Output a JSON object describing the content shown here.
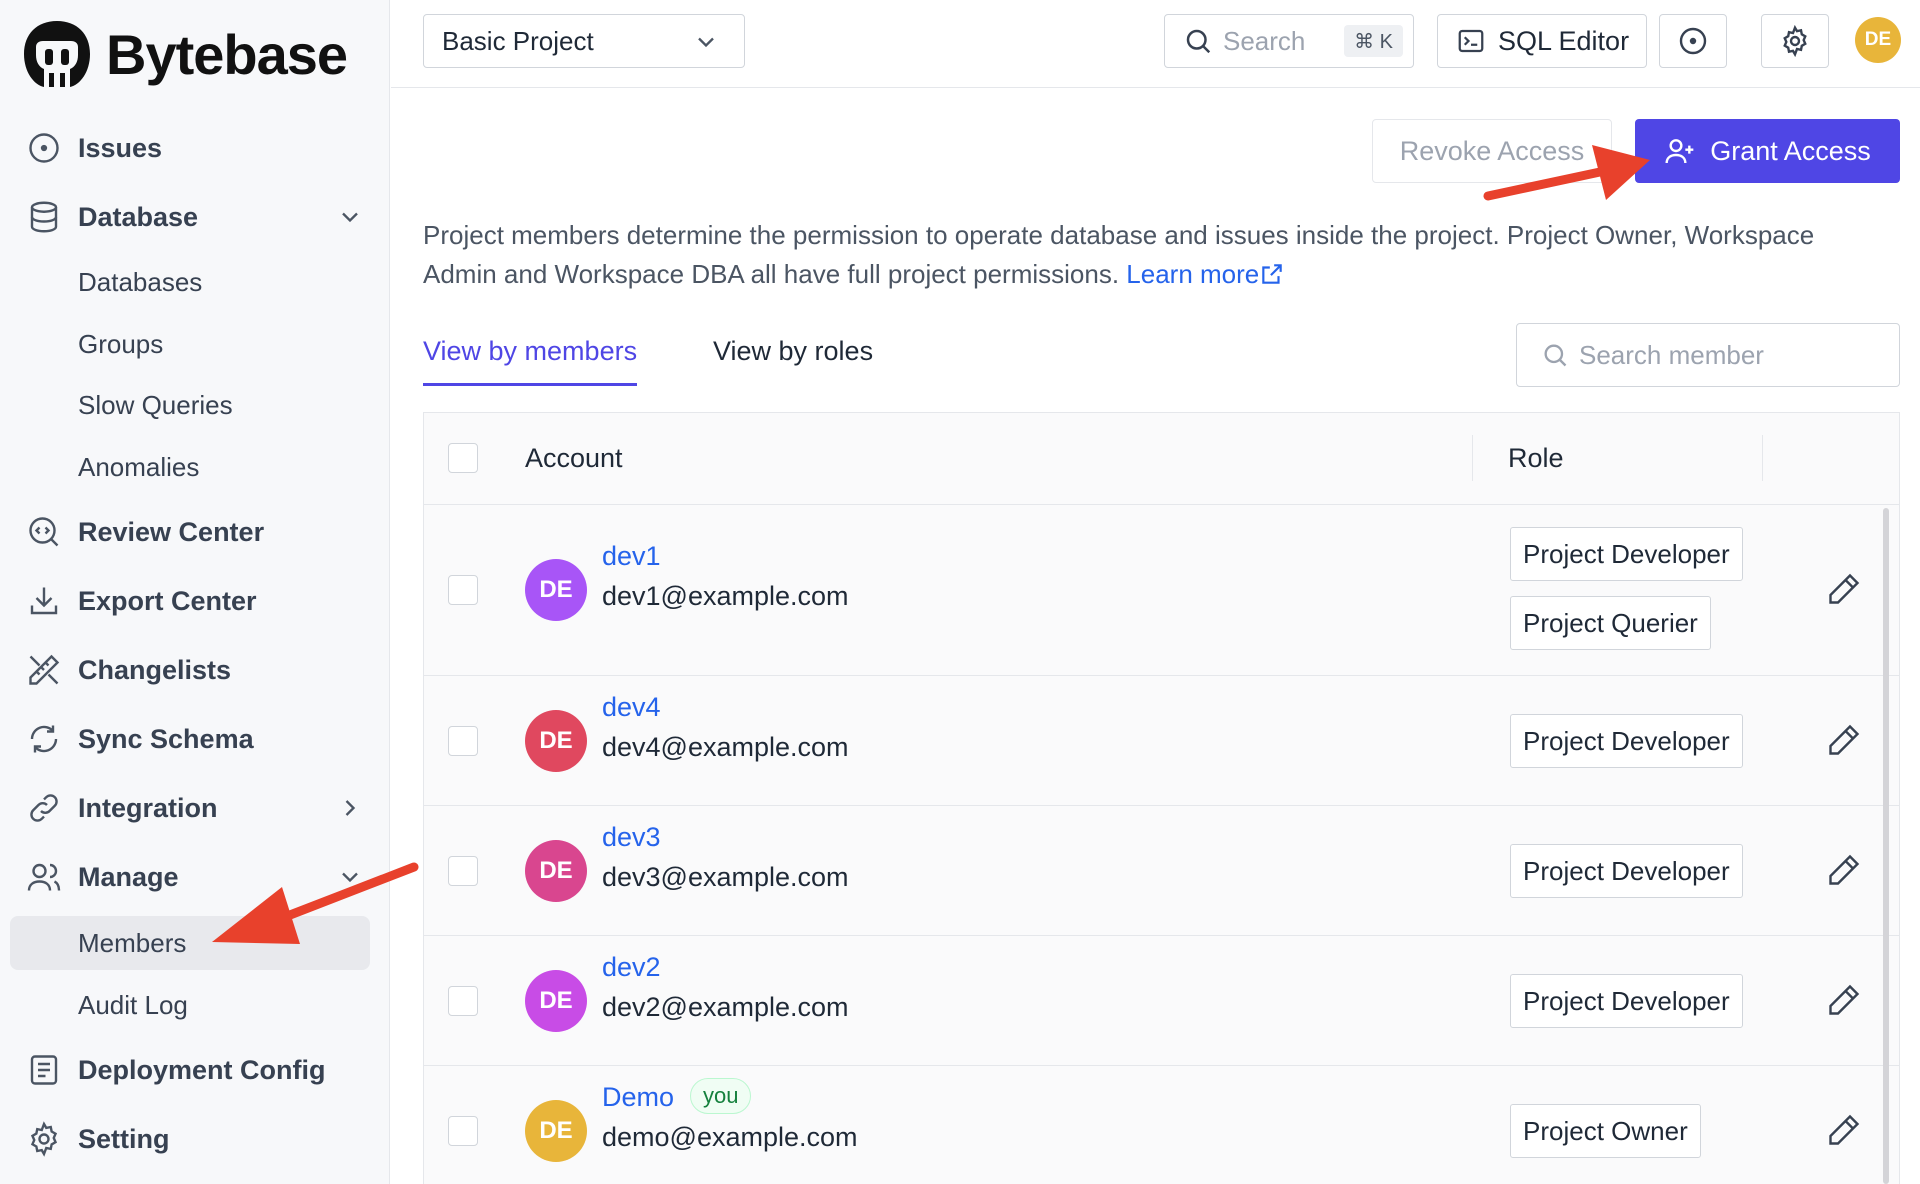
{
  "brand": {
    "name": "Bytebase"
  },
  "sidebar": {
    "items": [
      {
        "label": "Issues",
        "icon": "circle-dot-icon"
      },
      {
        "label": "Database",
        "icon": "database-icon",
        "expanded": true
      },
      {
        "label": "Review Center",
        "icon": "review-icon"
      },
      {
        "label": "Export Center",
        "icon": "download-icon"
      },
      {
        "label": "Changelists",
        "icon": "pencil-ruler-icon"
      },
      {
        "label": "Sync Schema",
        "icon": "refresh-icon"
      },
      {
        "label": "Integration",
        "icon": "link-icon"
      },
      {
        "label": "Manage",
        "icon": "users-icon",
        "expanded": true
      },
      {
        "label": "Deployment Config",
        "icon": "list-icon"
      },
      {
        "label": "Setting",
        "icon": "gear-icon"
      }
    ],
    "database_sub": [
      "Databases",
      "Groups",
      "Slow Queries",
      "Anomalies"
    ],
    "manage_sub": [
      "Members",
      "Audit Log"
    ],
    "active_sub": "Members"
  },
  "topbar": {
    "project": "Basic Project",
    "search_placeholder": "Search",
    "search_shortcut": "⌘ K",
    "sql_editor": "SQL Editor",
    "avatar": "DE"
  },
  "main": {
    "revoke_label": "Revoke Access",
    "grant_label": "Grant Access",
    "description": "Project members determine the permission to operate database and issues inside the project. Project Owner, Workspace Admin and Workspace DBA all have full project permissions.",
    "learn_more": "Learn more",
    "tabs": [
      "View by members",
      "View by roles"
    ],
    "member_search_placeholder": "Search member"
  },
  "table": {
    "headers": {
      "account": "Account",
      "role": "Role"
    },
    "rows": [
      {
        "avatar": "DE",
        "avatar_color": "#a855f7",
        "name": "dev1",
        "email": "dev1@example.com",
        "roles": [
          "Project Developer",
          "Project Querier"
        ],
        "you": false
      },
      {
        "avatar": "DE",
        "avatar_color": "#e0485f",
        "name": "dev4",
        "email": "dev4@example.com",
        "roles": [
          "Project Developer"
        ],
        "you": false
      },
      {
        "avatar": "DE",
        "avatar_color": "#d9468f",
        "name": "dev3",
        "email": "dev3@example.com",
        "roles": [
          "Project Developer"
        ],
        "you": false
      },
      {
        "avatar": "DE",
        "avatar_color": "#c84ce6",
        "name": "dev2",
        "email": "dev2@example.com",
        "roles": [
          "Project Developer"
        ],
        "you": false
      },
      {
        "avatar": "DE",
        "avatar_color": "#e8b53a",
        "name": "Demo",
        "email": "demo@example.com",
        "roles": [
          "Project Owner"
        ],
        "you": true,
        "you_label": "you"
      }
    ]
  },
  "colors": {
    "accent": "#4f46e5",
    "link": "#2563eb",
    "annotation": "#e8412c"
  }
}
